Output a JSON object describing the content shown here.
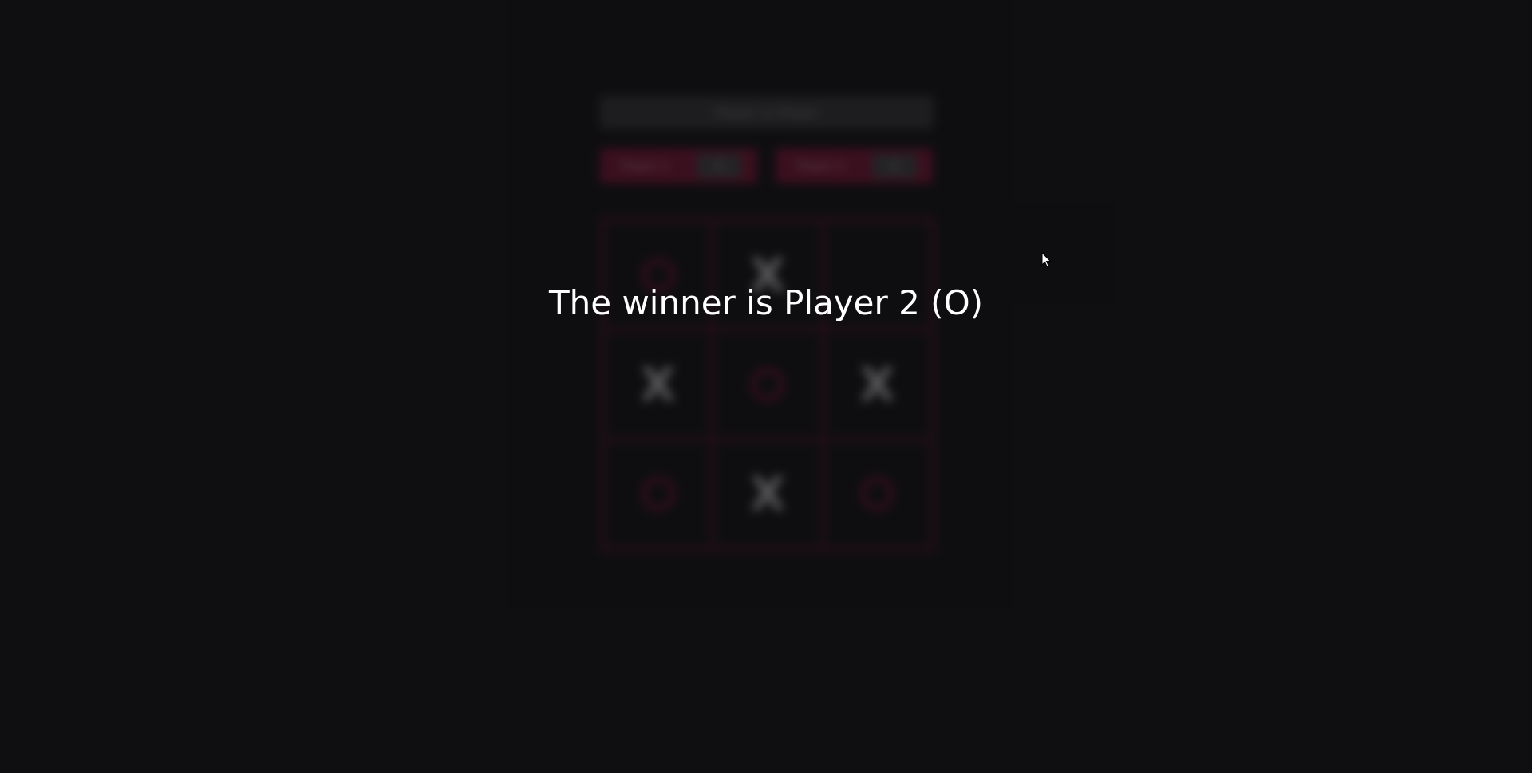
{
  "game": {
    "mode_label": "Player vs Player",
    "players": [
      {
        "name": "Player 1",
        "score": "0"
      },
      {
        "name": "Player 2",
        "score": "0"
      }
    ],
    "board": [
      "O",
      "X",
      "",
      "X",
      "O",
      "X",
      "O",
      "X",
      "O"
    ]
  },
  "overlay": {
    "message": "The winner is Player 2 (O)"
  },
  "colors": {
    "background": "#0f0f11",
    "accent": "#8c1236",
    "x_mark": "#d9d9d9",
    "o_mark": "#8a1233"
  }
}
